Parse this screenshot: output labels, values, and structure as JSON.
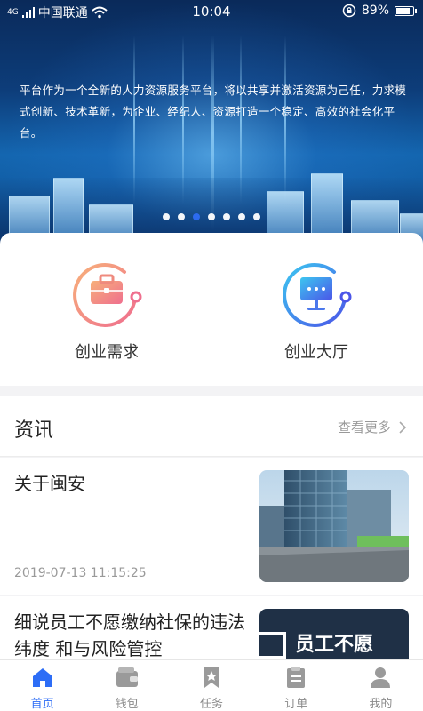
{
  "status": {
    "carrier": "中国联通",
    "signal_label": "4G",
    "time": "10:04",
    "battery": "89%",
    "battery_level": 0.89
  },
  "banner": {
    "text": "平台作为一个全新的人力资源服务平台，将以共享并激活资源为己任，力求模式创新、技术革新，为企业、经纪人、资源打造一个稳定、高效的社会化平台。",
    "dot_count": 7,
    "active_dot": 2
  },
  "features": [
    {
      "label": "创业需求",
      "icon": "briefcase-icon",
      "color": "#f08a8a"
    },
    {
      "label": "创业大厅",
      "icon": "monitor-chat-icon",
      "color": "#3f7df0"
    }
  ],
  "news": {
    "title": "资讯",
    "more_label": "查看更多",
    "items": [
      {
        "headline": "关于闽安",
        "date": "2019-07-13 11:15:25"
      },
      {
        "headline": "细说员工不愿缴纳社保的违法纬度 和与风险管控",
        "thumb_text": "员工不愿"
      }
    ]
  },
  "tabs": [
    {
      "label": "首页",
      "icon": "home-icon",
      "active": true
    },
    {
      "label": "钱包",
      "icon": "wallet-icon",
      "active": false
    },
    {
      "label": "任务",
      "icon": "bookmark-star-icon",
      "active": false
    },
    {
      "label": "订单",
      "icon": "clipboard-icon",
      "active": false
    },
    {
      "label": "我的",
      "icon": "person-icon",
      "active": false
    }
  ],
  "colors": {
    "accent": "#2d6df6",
    "tab_inactive": "#8a8a8a"
  }
}
